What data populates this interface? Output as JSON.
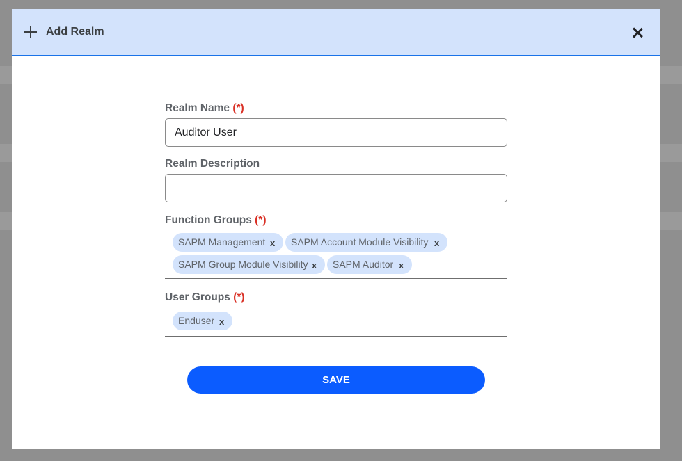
{
  "dialog": {
    "title": "Add Realm",
    "plus_icon": "plus-icon",
    "close_icon": "close-icon"
  },
  "form": {
    "realm_name": {
      "label": "Realm Name",
      "required_mark": "(*)",
      "value": "Auditor User"
    },
    "realm_description": {
      "label": "Realm Description",
      "value": ""
    },
    "function_groups": {
      "label": "Function Groups",
      "required_mark": "(*)",
      "chips": [
        "SAPM Management",
        "SAPM Account Module Visibility",
        "SAPM Group Module Visibility",
        "SAPM Auditor"
      ],
      "remove_glyph": "x"
    },
    "user_groups": {
      "label": "User Groups",
      "required_mark": "(*)",
      "chips": [
        "Enduser"
      ],
      "remove_glyph": "x"
    },
    "save_label": "SAVE"
  },
  "colors": {
    "header_bg": "#d3e3fc",
    "accent": "#1a73e8",
    "button": "#0b5cff",
    "required": "#d93025",
    "chip_bg": "#d3e3fc"
  }
}
